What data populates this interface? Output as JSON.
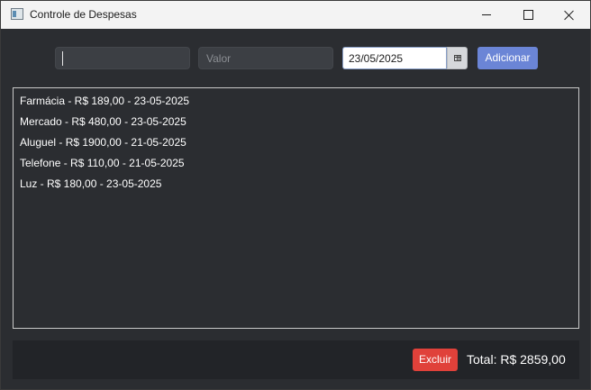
{
  "window": {
    "title": "Controle de Despesas"
  },
  "form": {
    "name_value": "",
    "value_placeholder": "Valor",
    "date_value": "23/05/2025",
    "add_label": "Adicionar"
  },
  "expenses": [
    "Farmácia - R$ 189,00 - 23-05-2025",
    "Mercado - R$ 480,00 - 23-05-2025",
    "Aluguel - R$ 1900,00 - 21-05-2025",
    "Telefone - R$ 110,00 - 21-05-2025",
    "Luz - R$ 180,00 - 23-05-2025"
  ],
  "footer": {
    "delete_label": "Excluir",
    "total": "Total: R$ 2859,00"
  },
  "colors": {
    "accent": "#6b85d6",
    "danger": "#e0413a",
    "background": "#2b2d31"
  },
  "icons": {
    "app": "app-window-icon",
    "calendar": "calendar-icon"
  }
}
